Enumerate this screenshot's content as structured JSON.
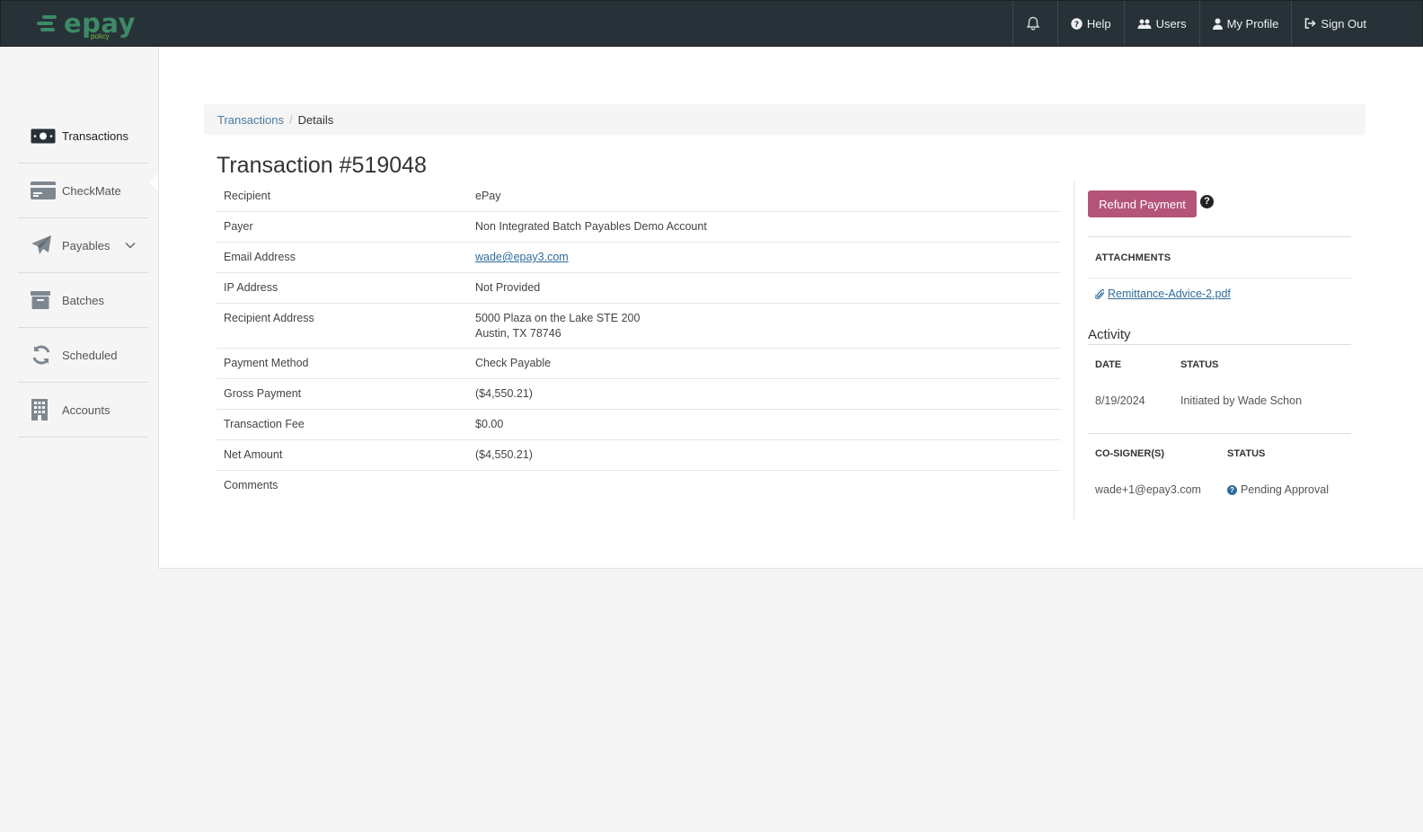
{
  "brand": {
    "name": "epay",
    "tagline": "policy"
  },
  "topnav": {
    "bell": "",
    "help": "Help",
    "users": "Users",
    "profile": "My Profile",
    "signout": "Sign Out"
  },
  "sidebar": {
    "items": [
      {
        "label": "Transactions",
        "icon": "money-icon",
        "active": true
      },
      {
        "label": "CheckMate",
        "icon": "card-icon"
      },
      {
        "label": "Payables",
        "icon": "paper-plane-icon"
      },
      {
        "label": "Batches",
        "icon": "archive-icon"
      },
      {
        "label": "Scheduled",
        "icon": "refresh-icon"
      },
      {
        "label": "Accounts",
        "icon": "building-icon"
      }
    ]
  },
  "breadcrumb": {
    "root": "Transactions",
    "current": "Details"
  },
  "title": "Transaction #519048",
  "details": [
    {
      "key": "Recipient",
      "value": "ePay"
    },
    {
      "key": "Payer",
      "value": "Non Integrated Batch Payables Demo Account"
    },
    {
      "key": "Email Address",
      "value": "wade@epay3.com"
    },
    {
      "key": "IP Address",
      "value": "Not Provided"
    },
    {
      "key": "Recipient Address",
      "value_line1": "5000 Plaza on the Lake STE 200",
      "value_line2": "Austin, TX 78746"
    },
    {
      "key": "Payment Method",
      "value": "Check Payable"
    },
    {
      "key": "Gross Payment",
      "value": "($4,550.21)"
    },
    {
      "key": "Transaction Fee",
      "value": "$0.00"
    },
    {
      "key": "Net Amount",
      "value": "($4,550.21)"
    },
    {
      "key": "Comments",
      "value": ""
    }
  ],
  "actions": {
    "refund": "Refund Payment",
    "help": "?"
  },
  "attachments": {
    "heading": "ATTACHMENTS",
    "file": "Remittance-Advice-2.pdf"
  },
  "activity": {
    "title": "Activity",
    "headers": {
      "date": "DATE",
      "status": "STATUS"
    },
    "rows": [
      {
        "date": "8/19/2024",
        "status": "Initiated by Wade Schon"
      }
    ]
  },
  "cosigners": {
    "headers": {
      "signer": "CO-SIGNER(S)",
      "status": "STATUS"
    },
    "rows": [
      {
        "signer": "wade+1@epay3.com",
        "status": "Pending Approval"
      }
    ]
  },
  "colors": {
    "topbar": "#273238",
    "refund": "#b5547a",
    "link": "#2f6b9a",
    "brand": "#3d8a66"
  }
}
